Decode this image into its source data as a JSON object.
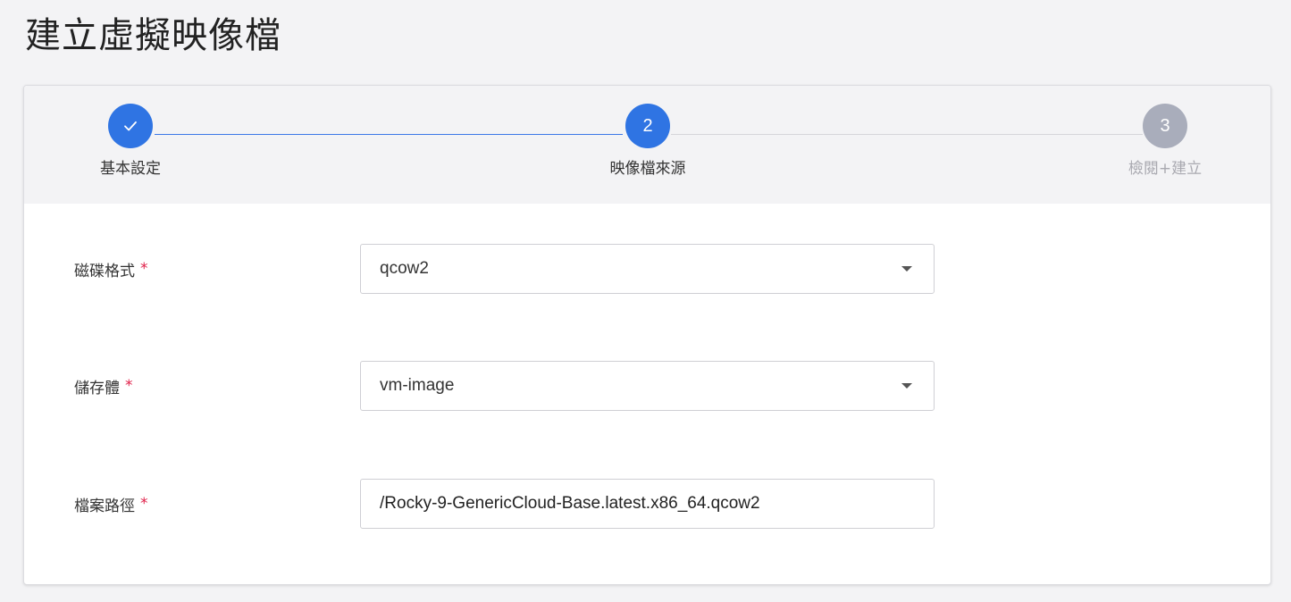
{
  "page": {
    "title": "建立虛擬映像檔"
  },
  "stepper": {
    "steps": [
      {
        "number": "✓",
        "label": "基本設定",
        "state": "completed"
      },
      {
        "number": "2",
        "label": "映像檔來源",
        "state": "current"
      },
      {
        "number": "3",
        "label": "檢閱+建立",
        "state": "upcoming"
      }
    ]
  },
  "form": {
    "required_mark": "*",
    "disk_format": {
      "label": "磁碟格式",
      "value": "qcow2"
    },
    "storage": {
      "label": "儲存體",
      "value": "vm-image"
    },
    "file_path": {
      "label": "檔案路徑",
      "value": "/Rocky-9-GenericCloud-Base.latest.x86_64.qcow2"
    }
  },
  "colors": {
    "accent": "#2f74e3",
    "inactive_step": "#a9adbb",
    "required": "#e0214a",
    "background": "#f3f3f5"
  }
}
